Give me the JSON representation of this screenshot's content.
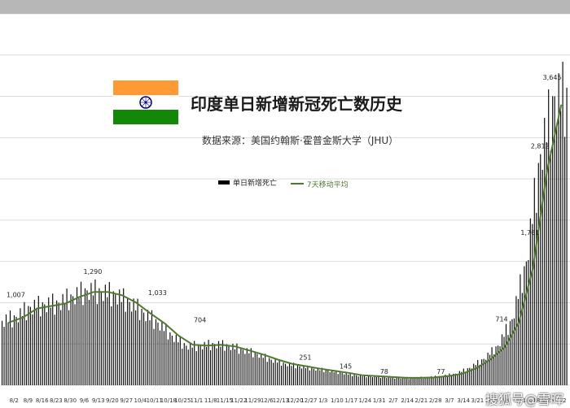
{
  "header": {
    "title": "印度单日新增新冠死亡数历史",
    "source": "数据来源：美国约翰斯·霍普金斯大学（JHU）",
    "watermark": "搜狐号@雪晖"
  },
  "legend": {
    "bars_label": "单日新增死亡",
    "ma_label": "7天移动平均"
  },
  "colors": {
    "bars": "#000000",
    "moving_average": "#4e7a2f",
    "gridlines": "#dcdcdc",
    "flag_saffron": "#ff9933",
    "flag_white": "#ffffff",
    "flag_green": "#138808",
    "flag_chakra": "#000080"
  },
  "chart_data": {
    "type": "bar",
    "title": "印度单日新增新冠死亡数历史",
    "subtitle": "数据来源：美国约翰斯·霍普金斯大学（JHU）",
    "series": [
      {
        "name": "单日新增死亡",
        "kind": "bar"
      },
      {
        "name": "7天移动平均",
        "kind": "line"
      }
    ],
    "x_tick_labels": [
      "8/2",
      "8/9",
      "8/16",
      "8/23",
      "8/30",
      "9/6",
      "9/13",
      "9/20",
      "9/27",
      "10/4",
      "10/11",
      "10/18",
      "10/25",
      "11/1",
      "11/8",
      "11/15",
      "11/22",
      "11/29",
      "12/6",
      "12/13",
      "12/20",
      "12/27",
      "1/3",
      "1/10",
      "1/17",
      "1/24",
      "1/31",
      "2/7",
      "2/14",
      "2/21",
      "2/28",
      "3/7",
      "3/14",
      "3/21",
      "3/28",
      "4/4",
      "4/11",
      "4/18",
      "4/25",
      "5/2"
    ],
    "weekly_daily_deaths": [
      780,
      830,
      950,
      980,
      1000,
      1080,
      1150,
      1140,
      1100,
      1010,
      880,
      760,
      600,
      480,
      480,
      500,
      480,
      430,
      380,
      310,
      260,
      230,
      200,
      180,
      150,
      120,
      110,
      100,
      90,
      90,
      95,
      110,
      140,
      210,
      320,
      480,
      800,
      1500,
      2800,
      3500
    ],
    "moving_average": [
      760,
      820,
      930,
      960,
      990,
      1070,
      1130,
      1130,
      1090,
      1000,
      870,
      750,
      600,
      490,
      480,
      490,
      470,
      420,
      370,
      310,
      260,
      230,
      200,
      175,
      150,
      120,
      110,
      100,
      92,
      90,
      95,
      110,
      140,
      205,
      310,
      460,
      760,
      1420,
      2600,
      3400
    ],
    "annotations": [
      {
        "x": "8/9",
        "value": 1007,
        "label": "1,007"
      },
      {
        "x": "9/16",
        "value": 1290,
        "label": "1,290"
      },
      {
        "x": "10/18",
        "value": 1033,
        "label": "1,033"
      },
      {
        "x": "11/8",
        "value": 704,
        "label": "704"
      },
      {
        "x": "12/30",
        "value": 251,
        "label": "251"
      },
      {
        "x": "1/19",
        "value": 145,
        "label": "145"
      },
      {
        "x": "2/7",
        "value": 78,
        "label": "78"
      },
      {
        "x": "3/7",
        "value": 77,
        "label": "77"
      },
      {
        "x": "4/6",
        "value": 714,
        "label": "714"
      },
      {
        "x": "4/20",
        "value": 1761,
        "label": "1,761"
      },
      {
        "x": "4/25",
        "value": 2812,
        "label": "2,812"
      },
      {
        "x": "5/1",
        "value": 3645,
        "label": "3,645"
      }
    ],
    "ylim": [
      0,
      4500
    ],
    "grid": true,
    "legend_position": "top-center"
  }
}
